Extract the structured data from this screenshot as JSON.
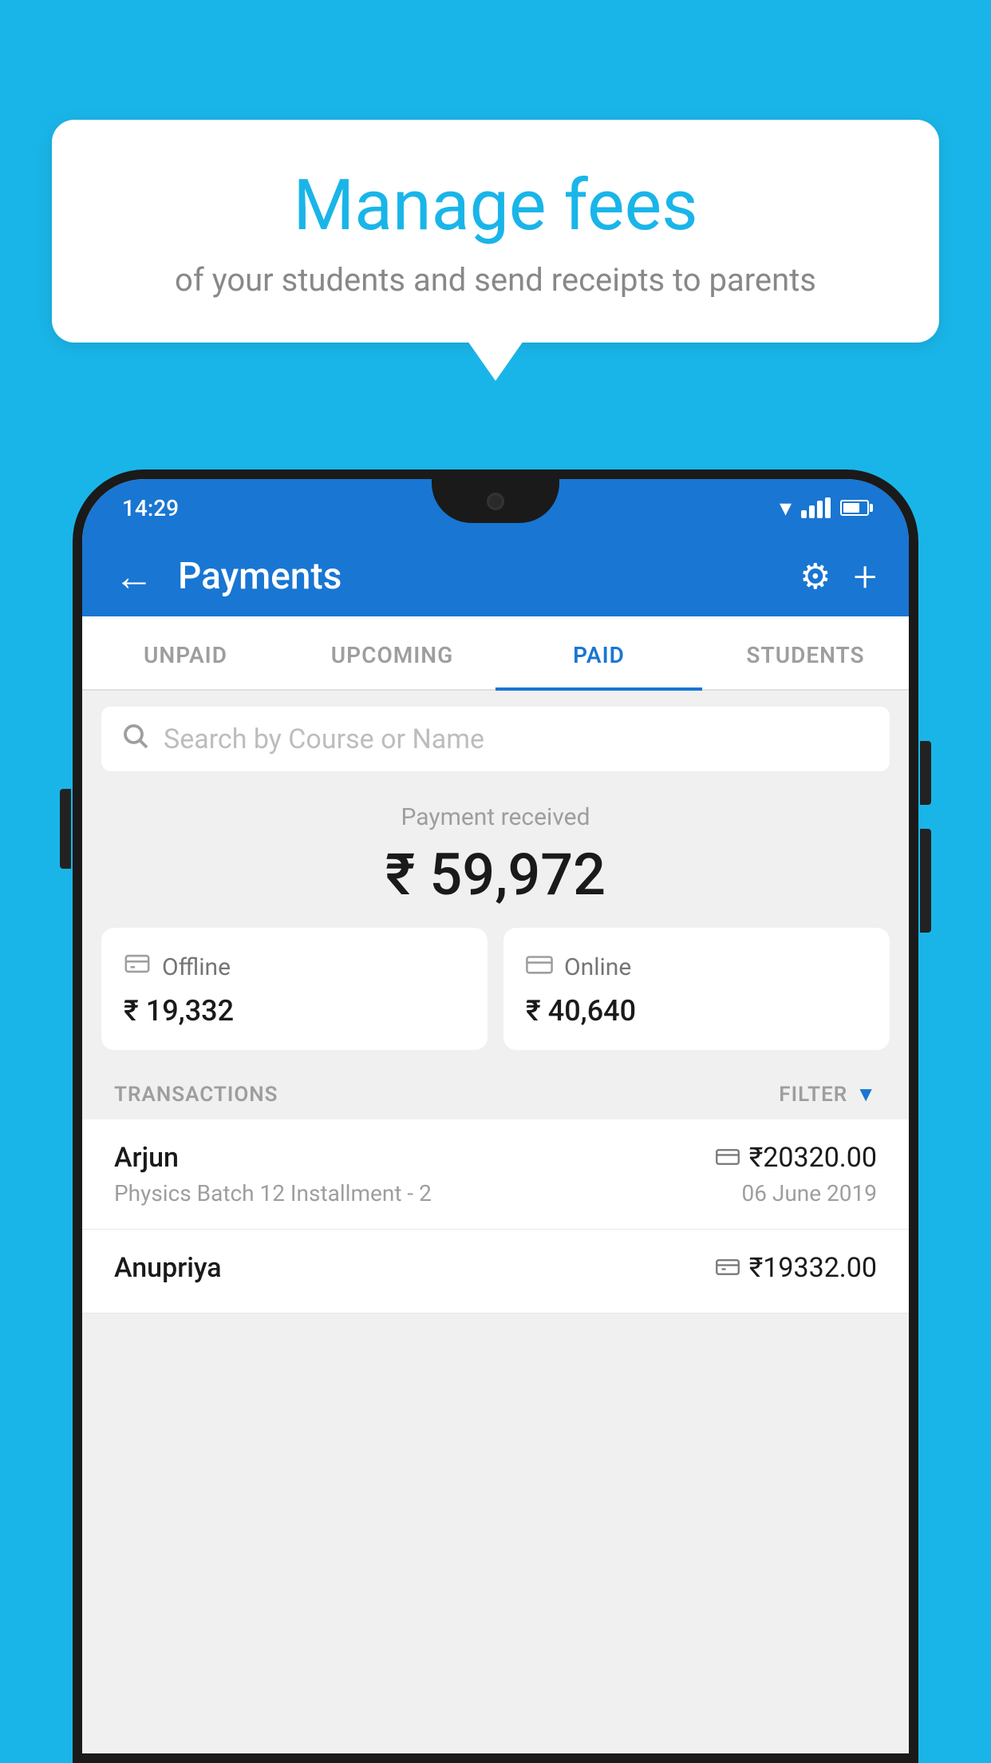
{
  "background_color": "#1ab5e8",
  "speech_bubble": {
    "title": "Manage fees",
    "subtitle": "of your students and send receipts to parents"
  },
  "status_bar": {
    "time": "14:29"
  },
  "app_header": {
    "title": "Payments",
    "settings_icon": "⚙",
    "add_icon": "+"
  },
  "tabs": [
    {
      "label": "UNPAID",
      "active": false
    },
    {
      "label": "UPCOMING",
      "active": false
    },
    {
      "label": "PAID",
      "active": true
    },
    {
      "label": "STUDENTS",
      "active": false
    }
  ],
  "search": {
    "placeholder": "Search by Course or Name"
  },
  "payment_received": {
    "label": "Payment received",
    "amount": "₹ 59,972"
  },
  "payment_cards": [
    {
      "type": "Offline",
      "amount": "₹ 19,332"
    },
    {
      "type": "Online",
      "amount": "₹ 40,640"
    }
  ],
  "transactions": {
    "label": "TRANSACTIONS",
    "filter_label": "FILTER"
  },
  "transaction_list": [
    {
      "name": "Arjun",
      "amount": "₹20320.00",
      "course": "Physics Batch 12 Installment - 2",
      "date": "06 June 2019",
      "icon": "card"
    },
    {
      "name": "Anupriya",
      "amount": "₹19332.00",
      "course": "",
      "date": "",
      "icon": "cash"
    }
  ]
}
